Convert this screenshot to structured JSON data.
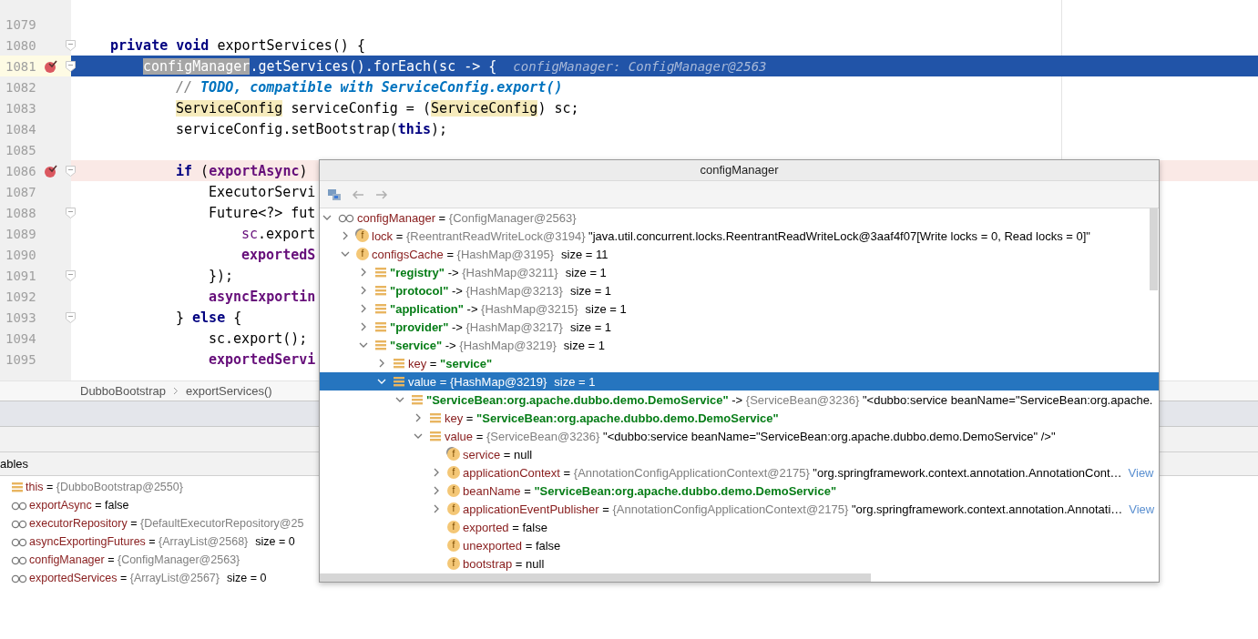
{
  "editor": {
    "lines": [
      {
        "number": "1079",
        "breakpoint": false,
        "current": false,
        "fold": false
      },
      {
        "number": "1080",
        "breakpoint": false,
        "current": false,
        "fold": true,
        "tokens": [
          {
            "t": "private ",
            "kind": "kw"
          },
          {
            "t": "void",
            "kind": "kw"
          },
          {
            "t": " exportServices() {",
            "kind": "plain"
          }
        ],
        "children": [
          {
            "number": "1081",
            "breakpoint": true,
            "current": true,
            "fold": true,
            "tokens": [
              {
                "t": "configManager",
                "kind": "sel"
              },
              {
                "t": ".getServices().forEach(sc -> {",
                "kind": "plain"
              }
            ],
            "hint": "configManager: ConfigManager@2563",
            "children": [
              {
                "number": "1082",
                "breakpoint": false,
                "current": false,
                "fold": false,
                "tokens": [
                  {
                    "t": "// ",
                    "kind": "comment"
                  },
                  {
                    "t": "TODO, compatible with ServiceConfig.export()",
                    "kind": "todo"
                  }
                ]
              },
              {
                "number": "1083",
                "breakpoint": false,
                "current": false,
                "fold": false,
                "tokens": [
                  {
                    "t": "ServiceConfig",
                    "kind": "mark"
                  },
                  {
                    "t": " serviceConfig = (",
                    "kind": "plain"
                  },
                  {
                    "t": "ServiceConfig",
                    "kind": "mark"
                  },
                  {
                    "t": ") sc;",
                    "kind": "plain"
                  }
                ]
              },
              {
                "number": "1084",
                "breakpoint": false,
                "current": false,
                "fold": false,
                "tokens": [
                  {
                    "t": "serviceConfig.setBootstrap(",
                    "kind": "plain"
                  },
                  {
                    "t": "this",
                    "kind": "kw"
                  },
                  {
                    "t": ");",
                    "kind": "plain"
                  }
                ]
              },
              {
                "number": "1085",
                "breakpoint": false,
                "current": false,
                "fold": false
              },
              {
                "number": "1086",
                "breakpoint": true,
                "current": false,
                "fold": true,
                "tokens": [
                  {
                    "t": "if",
                    "kind": "kw"
                  },
                  {
                    "t": " (",
                    "kind": "plain"
                  },
                  {
                    "t": "exportAsync",
                    "kind": "field"
                  },
                  {
                    "t": ")",
                    "kind": "plain"
                  }
                ],
                "children": [
                  {
                    "number": "1087",
                    "breakpoint": false,
                    "current": false,
                    "fold": false,
                    "tokens": [
                      {
                        "t": "ExecutorServi",
                        "kind": "plain"
                      }
                    ]
                  },
                  {
                    "number": "1088",
                    "breakpoint": false,
                    "current": false,
                    "fold": true,
                    "tokens": [
                      {
                        "t": "Future<?> fut",
                        "kind": "plain"
                      }
                    ],
                    "children": [
                      {
                        "number": "1089",
                        "breakpoint": false,
                        "current": false,
                        "fold": false,
                        "tokens": [
                          {
                            "t": "sc",
                            "kind": "param"
                          },
                          {
                            "t": ".export",
                            "kind": "plain"
                          }
                        ]
                      },
                      {
                        "number": "1090",
                        "breakpoint": false,
                        "current": false,
                        "fold": false,
                        "tokens": [
                          {
                            "t": "exportedS",
                            "kind": "field"
                          }
                        ]
                      }
                    ]
                  },
                  {
                    "number": "1091",
                    "breakpoint": false,
                    "current": false,
                    "fold": true,
                    "tokens": [
                      {
                        "t": "});",
                        "kind": "plain"
                      }
                    ]
                  },
                  {
                    "number": "1092",
                    "breakpoint": false,
                    "current": false,
                    "fold": false,
                    "tokens": [
                      {
                        "t": "asyncExportin",
                        "kind": "field"
                      }
                    ]
                  }
                ]
              },
              {
                "number": "1093",
                "breakpoint": false,
                "current": false,
                "fold": true,
                "tokens": [
                  {
                    "t": "} ",
                    "kind": "plain"
                  },
                  {
                    "t": "else",
                    "kind": "kw"
                  },
                  {
                    "t": " {",
                    "kind": "plain"
                  }
                ],
                "children": [
                  {
                    "number": "1094",
                    "breakpoint": false,
                    "current": false,
                    "fold": false,
                    "tokens": [
                      {
                        "t": "sc.export();",
                        "kind": "plain"
                      }
                    ]
                  },
                  {
                    "number": "1095",
                    "breakpoint": false,
                    "current": false,
                    "fold": false,
                    "tokens": [
                      {
                        "t": "exportedServi",
                        "kind": "field"
                      }
                    ]
                  }
                ]
              }
            ]
          }
        ]
      }
    ],
    "breadcrumbs": [
      "DubboBootstrap",
      "exportServices()"
    ]
  },
  "variables_panel": {
    "title": "ables",
    "rows": [
      {
        "kind": "stack",
        "parts": [
          {
            "t": "this",
            "kind": "name"
          },
          {
            "t": " = ",
            "kind": "op"
          },
          {
            "t": "{DubboBootstrap@2550}",
            "kind": "ref"
          }
        ]
      },
      {
        "kind": "watch",
        "parts": [
          {
            "t": "exportAsync",
            "kind": "name"
          },
          {
            "t": " = ",
            "kind": "op"
          },
          {
            "t": "false",
            "kind": "plain"
          }
        ]
      },
      {
        "kind": "watch",
        "parts": [
          {
            "t": "executorRepository",
            "kind": "name"
          },
          {
            "t": " = ",
            "kind": "op"
          },
          {
            "t": "{DefaultExecutorRepository@25",
            "kind": "ref"
          }
        ]
      },
      {
        "kind": "watch",
        "parts": [
          {
            "t": "asyncExportingFutures",
            "kind": "name"
          },
          {
            "t": " = ",
            "kind": "op"
          },
          {
            "t": "{ArrayList@2568}",
            "kind": "ref"
          },
          {
            "t": "size = 0",
            "kind": "extra"
          }
        ]
      },
      {
        "kind": "watch",
        "parts": [
          {
            "t": "configManager",
            "kind": "name"
          },
          {
            "t": " = ",
            "kind": "op"
          },
          {
            "t": "{ConfigManager@2563}",
            "kind": "ref"
          }
        ]
      },
      {
        "kind": "watch",
        "parts": [
          {
            "t": "exportedServices",
            "kind": "name"
          },
          {
            "t": " = ",
            "kind": "op"
          },
          {
            "t": "{ArrayList@2567}",
            "kind": "ref"
          },
          {
            "t": "size = 0",
            "kind": "extra"
          }
        ]
      }
    ]
  },
  "popup": {
    "title": "configManager",
    "tree": [
      {
        "kind": "watch",
        "expandable": true,
        "expanded": true,
        "selected": false,
        "parts": [
          {
            "t": "configManager",
            "kind": "name"
          },
          {
            "t": " = ",
            "kind": "op"
          },
          {
            "t": "{ConfigManager@2563}",
            "kind": "ref"
          }
        ],
        "children": [
          {
            "kind": "field-final",
            "badge": "f",
            "expandable": true,
            "expanded": false,
            "selected": false,
            "parts": [
              {
                "t": "lock",
                "kind": "name"
              },
              {
                "t": " = ",
                "kind": "op"
              },
              {
                "t": "{ReentrantReadWriteLock@3194}",
                "kind": "ref"
              },
              {
                "t": " \"java.util.concurrent.locks.ReentrantReadWriteLock@3aaf4f07[Write locks = 0, Read locks = 0]\"",
                "kind": "plain"
              }
            ]
          },
          {
            "kind": "field",
            "badge": "f",
            "expandable": true,
            "expanded": true,
            "selected": false,
            "parts": [
              {
                "t": "configsCache",
                "kind": "name"
              },
              {
                "t": " = ",
                "kind": "op"
              },
              {
                "t": "{HashMap@3195}",
                "kind": "ref"
              },
              {
                "t": "size = 11",
                "kind": "extra"
              }
            ],
            "children": [
              {
                "kind": "entry",
                "expandable": true,
                "expanded": false,
                "selected": false,
                "parts": [
                  {
                    "t": "\"registry\"",
                    "kind": "str"
                  },
                  {
                    "t": " -> ",
                    "kind": "op"
                  },
                  {
                    "t": "{HashMap@3211}",
                    "kind": "ref"
                  },
                  {
                    "t": "size = 1",
                    "kind": "extra"
                  }
                ]
              },
              {
                "kind": "entry",
                "expandable": true,
                "expanded": false,
                "selected": false,
                "parts": [
                  {
                    "t": "\"protocol\"",
                    "kind": "str"
                  },
                  {
                    "t": " -> ",
                    "kind": "op"
                  },
                  {
                    "t": "{HashMap@3213}",
                    "kind": "ref"
                  },
                  {
                    "t": "size = 1",
                    "kind": "extra"
                  }
                ]
              },
              {
                "kind": "entry",
                "expandable": true,
                "expanded": false,
                "selected": false,
                "parts": [
                  {
                    "t": "\"application\"",
                    "kind": "str"
                  },
                  {
                    "t": " -> ",
                    "kind": "op"
                  },
                  {
                    "t": "{HashMap@3215}",
                    "kind": "ref"
                  },
                  {
                    "t": "size = 1",
                    "kind": "extra"
                  }
                ]
              },
              {
                "kind": "entry",
                "expandable": true,
                "expanded": false,
                "selected": false,
                "parts": [
                  {
                    "t": "\"provider\"",
                    "kind": "str"
                  },
                  {
                    "t": " -> ",
                    "kind": "op"
                  },
                  {
                    "t": "{HashMap@3217}",
                    "kind": "ref"
                  },
                  {
                    "t": "size = 1",
                    "kind": "extra"
                  }
                ]
              },
              {
                "kind": "entry",
                "expandable": true,
                "expanded": true,
                "selected": false,
                "parts": [
                  {
                    "t": "\"service\"",
                    "kind": "str"
                  },
                  {
                    "t": " -> ",
                    "kind": "op"
                  },
                  {
                    "t": "{HashMap@3219}",
                    "kind": "ref"
                  },
                  {
                    "t": "size = 1",
                    "kind": "extra"
                  }
                ],
                "children": [
                  {
                    "kind": "entry",
                    "expandable": true,
                    "expanded": false,
                    "selected": false,
                    "parts": [
                      {
                        "t": "key",
                        "kind": "name"
                      },
                      {
                        "t": " = ",
                        "kind": "op"
                      },
                      {
                        "t": "\"service\"",
                        "kind": "str"
                      }
                    ]
                  },
                  {
                    "kind": "entry",
                    "expandable": true,
                    "expanded": true,
                    "selected": true,
                    "parts": [
                      {
                        "t": "value",
                        "kind": "name"
                      },
                      {
                        "t": " = ",
                        "kind": "op"
                      },
                      {
                        "t": "{HashMap@3219}",
                        "kind": "ref"
                      },
                      {
                        "t": "size = 1",
                        "kind": "extra"
                      }
                    ],
                    "children": [
                      {
                        "kind": "entry",
                        "expandable": true,
                        "expanded": true,
                        "selected": false,
                        "parts": [
                          {
                            "t": "\"ServiceBean:org.apache.dubbo.demo.DemoService\"",
                            "kind": "str"
                          },
                          {
                            "t": " -> ",
                            "kind": "op"
                          },
                          {
                            "t": "{ServiceBean@3236}",
                            "kind": "ref"
                          },
                          {
                            "t": " \"<dubbo:service beanName=\"ServiceBean:org.apache.",
                            "kind": "plain"
                          }
                        ],
                        "children": [
                          {
                            "kind": "entry",
                            "expandable": true,
                            "expanded": false,
                            "selected": false,
                            "parts": [
                              {
                                "t": "key",
                                "kind": "name"
                              },
                              {
                                "t": " = ",
                                "kind": "op"
                              },
                              {
                                "t": "\"ServiceBean:org.apache.dubbo.demo.DemoService\"",
                                "kind": "str"
                              }
                            ]
                          },
                          {
                            "kind": "entry",
                            "expandable": true,
                            "expanded": true,
                            "selected": false,
                            "parts": [
                              {
                                "t": "value",
                                "kind": "name"
                              },
                              {
                                "t": " = ",
                                "kind": "op"
                              },
                              {
                                "t": "{ServiceBean@3236}",
                                "kind": "ref"
                              },
                              {
                                "t": " \"<dubbo:service beanName=\"ServiceBean:org.apache.dubbo.demo.DemoService\" />\"",
                                "kind": "plain"
                              }
                            ],
                            "children": [
                              {
                                "kind": "field-final",
                                "badge": "f",
                                "expandable": false,
                                "selected": false,
                                "parts": [
                                  {
                                    "t": "service",
                                    "kind": "name"
                                  },
                                  {
                                    "t": " = ",
                                    "kind": "op"
                                  },
                                  {
                                    "t": "null",
                                    "kind": "plain"
                                  }
                                ]
                              },
                              {
                                "kind": "field",
                                "badge": "f",
                                "expandable": true,
                                "expanded": false,
                                "selected": false,
                                "parts": [
                                  {
                                    "t": "applicationContext",
                                    "kind": "name"
                                  },
                                  {
                                    "t": " = ",
                                    "kind": "op"
                                  },
                                  {
                                    "t": "{AnnotationConfigApplicationContext@2175}",
                                    "kind": "ref"
                                  },
                                  {
                                    "t": " \"org.springframework.context.annotation.AnnotationCont…",
                                    "kind": "plain"
                                  }
                                ],
                                "link": "View"
                              },
                              {
                                "kind": "field",
                                "badge": "f",
                                "expandable": true,
                                "expanded": false,
                                "selected": false,
                                "parts": [
                                  {
                                    "t": "beanName",
                                    "kind": "name"
                                  },
                                  {
                                    "t": " = ",
                                    "kind": "op"
                                  },
                                  {
                                    "t": "\"ServiceBean:org.apache.dubbo.demo.DemoService\"",
                                    "kind": "str"
                                  }
                                ]
                              },
                              {
                                "kind": "field",
                                "badge": "f",
                                "expandable": true,
                                "expanded": false,
                                "selected": false,
                                "parts": [
                                  {
                                    "t": "applicationEventPublisher",
                                    "kind": "name"
                                  },
                                  {
                                    "t": " = ",
                                    "kind": "op"
                                  },
                                  {
                                    "t": "{AnnotationConfigApplicationContext@2175}",
                                    "kind": "ref"
                                  },
                                  {
                                    "t": " \"org.springframework.context.annotation.Annotati…",
                                    "kind": "plain"
                                  }
                                ],
                                "link": "View"
                              },
                              {
                                "kind": "field",
                                "badge": "f",
                                "expandable": false,
                                "selected": false,
                                "parts": [
                                  {
                                    "t": "exported",
                                    "kind": "name"
                                  },
                                  {
                                    "t": " = ",
                                    "kind": "op"
                                  },
                                  {
                                    "t": "false",
                                    "kind": "plain"
                                  }
                                ]
                              },
                              {
                                "kind": "field",
                                "badge": "f",
                                "expandable": false,
                                "selected": false,
                                "parts": [
                                  {
                                    "t": "unexported",
                                    "kind": "name"
                                  },
                                  {
                                    "t": " = ",
                                    "kind": "op"
                                  },
                                  {
                                    "t": "false",
                                    "kind": "plain"
                                  }
                                ]
                              },
                              {
                                "kind": "field",
                                "badge": "f",
                                "expandable": false,
                                "selected": false,
                                "parts": [
                                  {
                                    "t": "bootstrap",
                                    "kind": "name"
                                  },
                                  {
                                    "t": " = ",
                                    "kind": "op"
                                  },
                                  {
                                    "t": "null",
                                    "kind": "plain"
                                  }
                                ]
                              }
                            ]
                          }
                        ]
                      }
                    ]
                  }
                ]
              }
            ]
          }
        ]
      }
    ]
  }
}
